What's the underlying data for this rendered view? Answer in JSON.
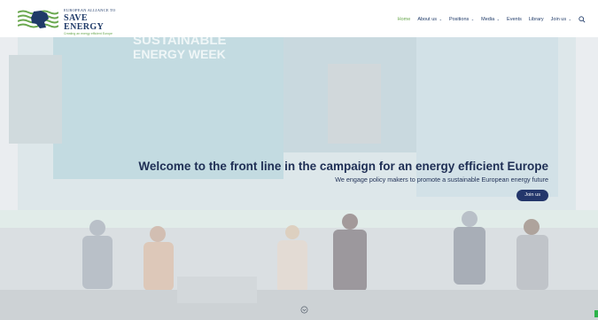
{
  "brand": {
    "line1": "EUROPEAN ALLIANCE TO",
    "line2": "SAVE ENERGY",
    "line3": "Creating an energy efficient Europe"
  },
  "nav": {
    "items": [
      {
        "label": "Home",
        "active": true,
        "has_dropdown": false
      },
      {
        "label": "About us",
        "active": false,
        "has_dropdown": true
      },
      {
        "label": "Positions",
        "active": false,
        "has_dropdown": true
      },
      {
        "label": "Media",
        "active": false,
        "has_dropdown": true
      },
      {
        "label": "Events",
        "active": false,
        "has_dropdown": false
      },
      {
        "label": "Library",
        "active": false,
        "has_dropdown": false
      },
      {
        "label": "Join us",
        "active": false,
        "has_dropdown": true
      }
    ],
    "caret": "⌄"
  },
  "hero": {
    "title": "Welcome to the front line in the campaign for an energy efficient Europe",
    "subtitle": "We engage policy makers to promote a sustainable European energy future",
    "cta_label": "Join us",
    "backdrop_text_line1": "SUSTAINABLE",
    "backdrop_text_line2": "ENERGY WEEK"
  },
  "colors": {
    "brand_navy": "#1f3a68",
    "brand_green": "#6aa84f",
    "cta_bg": "#23366b"
  }
}
